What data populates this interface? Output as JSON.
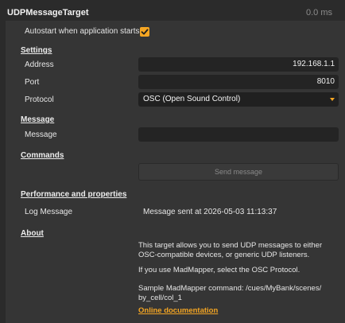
{
  "header": {
    "title": "UDPMessageTarget",
    "timing": "0.0 ms"
  },
  "autostart": {
    "label": "Autostart when application starts",
    "checked": true
  },
  "settings": {
    "heading": "Settings",
    "address_label": "Address",
    "address_value": "192.168.1.1",
    "port_label": "Port",
    "port_value": "8010",
    "protocol_label": "Protocol",
    "protocol_value": "OSC (Open Sound Control)"
  },
  "message": {
    "heading": "Message",
    "message_label": "Message",
    "message_value": ""
  },
  "commands": {
    "heading": "Commands",
    "send_label": "Send message"
  },
  "performance": {
    "heading": "Performance and properties",
    "log_label": "Log Message",
    "log_value": "Message sent at 2026-05-03 11:13:37"
  },
  "about": {
    "heading": "About",
    "line1": "This target allows you to send UDP messages to either",
    "line2": "OSC-compatible devices, or generic UDP listeners.",
    "line3": "If you use MadMapper, select the OSC Protocol.",
    "line4": "Sample MadMapper command: /cues/MyBank/scenes/",
    "line5": "by_cell/col_1",
    "link": "Online documentation"
  },
  "colors": {
    "accent": "#f5a623",
    "background": "#2b2b2b",
    "panel": "#353535",
    "field": "#242424"
  }
}
